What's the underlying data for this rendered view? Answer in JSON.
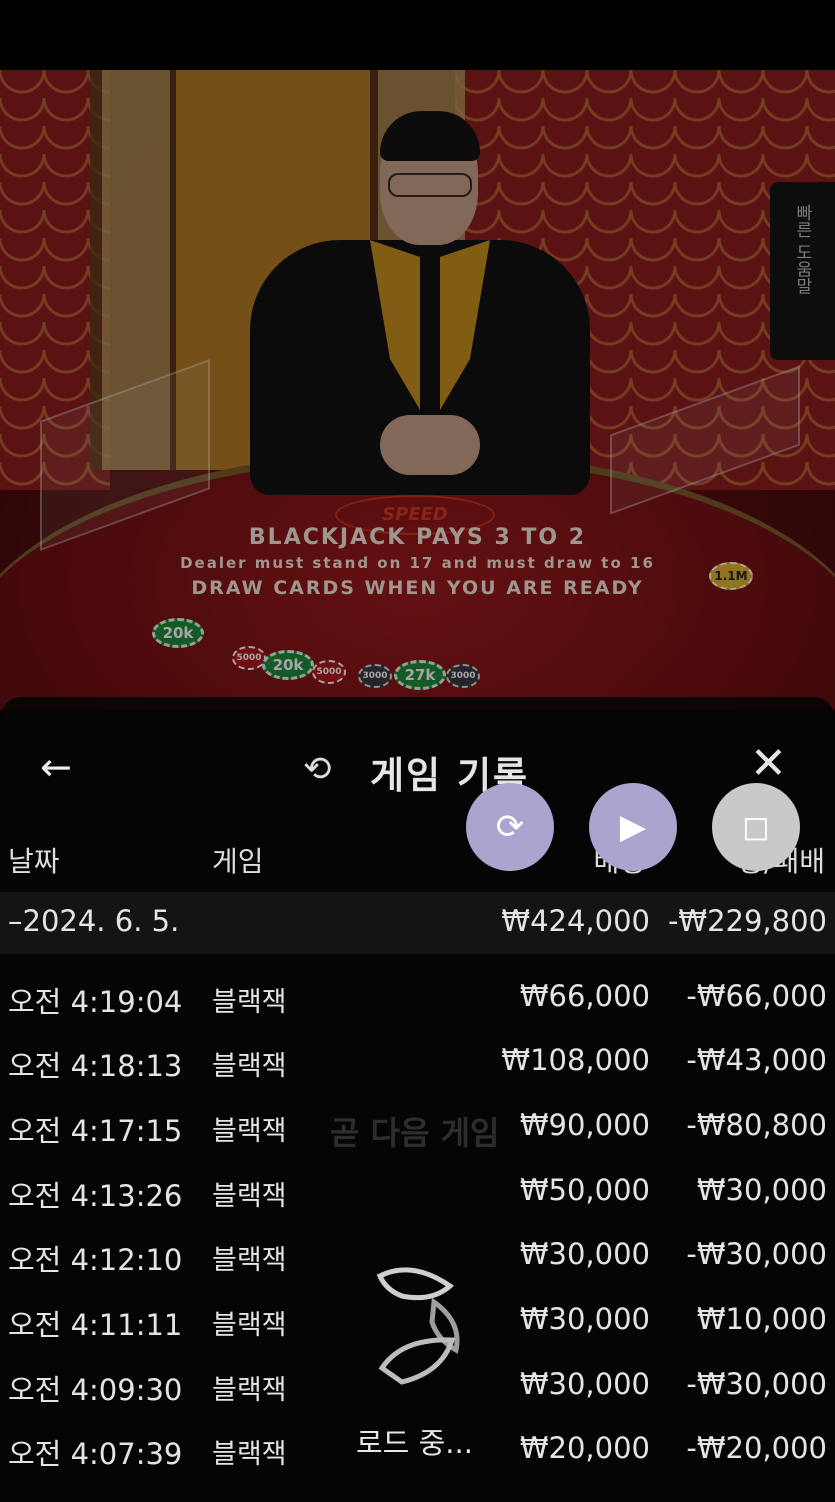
{
  "stream": {
    "speed_logo": "SPEED",
    "table_text_1": "BLACKJACK PAYS 3 TO 2",
    "table_text_2": "Dealer must stand on 17 and must draw to 16",
    "table_text_3": "DRAW CARDS WHEN YOU ARE READY",
    "chips": [
      "20k",
      "5000",
      "20k",
      "5000",
      "3000",
      "27k",
      "3000",
      "1.1M"
    ],
    "quick_help_label": "빠른 도움말"
  },
  "history": {
    "title": "게임 기록",
    "back_icon": "arrow-left-icon",
    "history_icon": "history-clock-icon",
    "close_icon": "close-icon",
    "columns": {
      "date": "날짜",
      "game": "게임",
      "bet": "배팅",
      "win_loss": "승/패배"
    },
    "summary": {
      "date": "–2024. 6. 5.",
      "bet": "₩424,000",
      "win_loss": "-₩229,800"
    },
    "rows": [
      {
        "time": "오전 4:19:04",
        "game": "블랙잭",
        "bet": "₩66,000",
        "win_loss": "-₩66,000"
      },
      {
        "time": "오전 4:18:13",
        "game": "블랙잭",
        "bet": "₩108,000",
        "win_loss": "-₩43,000"
      },
      {
        "time": "오전 4:17:15",
        "game": "블랙잭",
        "bet": "₩90,000",
        "win_loss": "-₩80,800"
      },
      {
        "time": "오전 4:13:26",
        "game": "블랙잭",
        "bet": "₩50,000",
        "win_loss": "₩30,000"
      },
      {
        "time": "오전 4:12:10",
        "game": "블랙잭",
        "bet": "₩30,000",
        "win_loss": "-₩30,000"
      },
      {
        "time": "오전 4:11:11",
        "game": "블랙잭",
        "bet": "₩30,000",
        "win_loss": "₩10,000"
      },
      {
        "time": "오전 4:09:30",
        "game": "블랙잭",
        "bet": "₩30,000",
        "win_loss": "-₩30,000"
      },
      {
        "time": "오전 4:07:39",
        "game": "블랙잭",
        "bet": "₩20,000",
        "win_loss": "-₩20,000"
      }
    ]
  },
  "floating_buttons": [
    {
      "icon": "rotate-screen-icon"
    },
    {
      "icon": "replay-icon"
    },
    {
      "icon": "stop-icon"
    }
  ],
  "loading": {
    "background_text": "곧 다음 게임",
    "text": "로드 중..."
  },
  "colors": {
    "fab_purple": "#a9a5cf",
    "fab_grey": "#c9c9c9",
    "panel_bg": "#060606",
    "table_red": "#8b1a1c"
  }
}
